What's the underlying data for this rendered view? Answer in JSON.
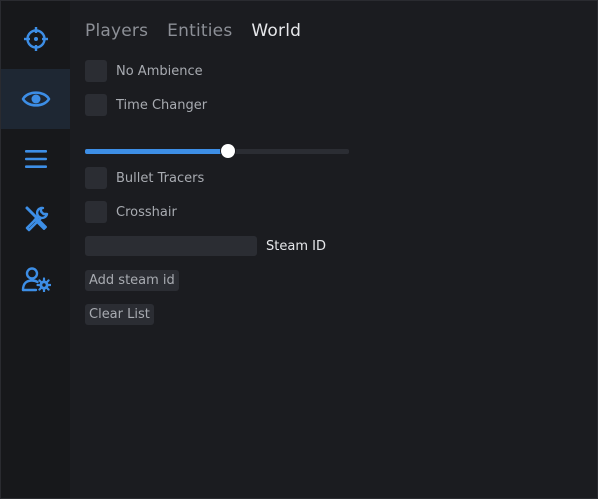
{
  "sidebar": {
    "items": [
      {
        "icon": "crosshair-icon",
        "active": false
      },
      {
        "icon": "eye-icon",
        "active": true
      },
      {
        "icon": "menu-icon",
        "active": false
      },
      {
        "icon": "tools-icon",
        "active": false
      },
      {
        "icon": "user-settings-icon",
        "active": false
      }
    ],
    "accent": "#3d8ee6"
  },
  "tabs": [
    {
      "label": "Players",
      "active": false
    },
    {
      "label": "Entities",
      "active": false
    },
    {
      "label": "World",
      "active": true
    }
  ],
  "world": {
    "no_ambience": {
      "label": "No Ambience",
      "checked": false
    },
    "time_changer": {
      "label": "Time Changer",
      "checked": false
    },
    "time_slider": {
      "value_fraction": 0.54
    },
    "bullet_tracers": {
      "label": "Bullet Tracers",
      "checked": false
    },
    "crosshair": {
      "label": "Crosshair",
      "checked": false
    },
    "steam_id": {
      "label": "Steam ID",
      "value": ""
    },
    "add_steam_id_button": "Add steam id",
    "clear_list_button": "Clear List"
  }
}
